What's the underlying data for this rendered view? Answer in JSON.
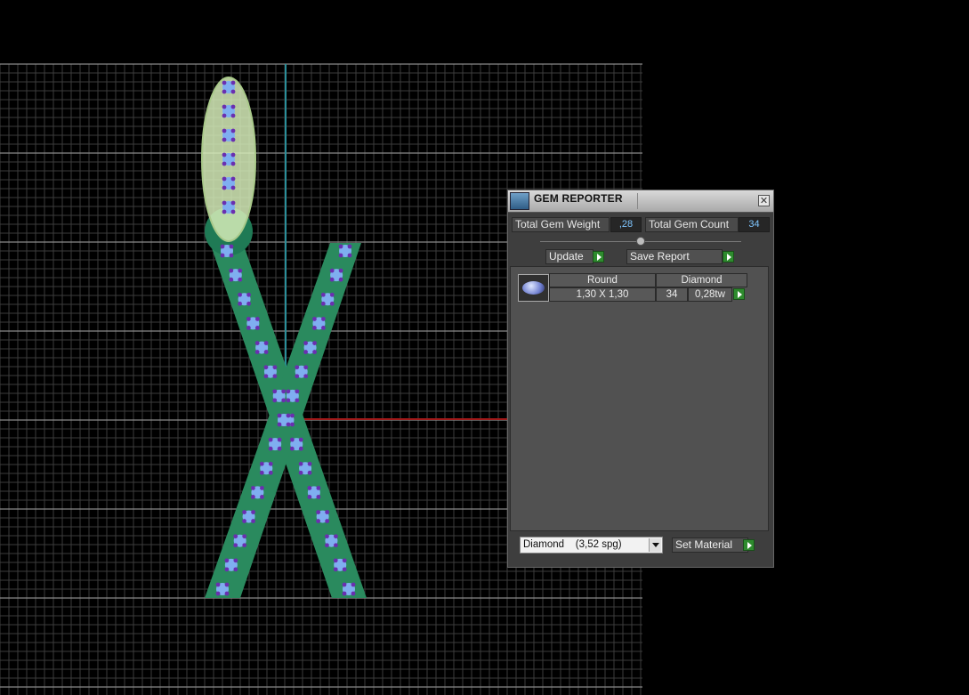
{
  "panel": {
    "title": "GEM REPORTER",
    "close_glyph": "✕",
    "total_weight_label": "Total Gem Weight",
    "total_weight_value": ",28",
    "total_count_label": "Total Gem Count",
    "total_count_value": "34",
    "update_label": "Update",
    "save_report_label": "Save Report",
    "gem_rows": [
      {
        "shape": "Round",
        "material": "Diamond",
        "size": "1,30 X 1,30",
        "count": "34",
        "weight": "0,28tw"
      }
    ],
    "material_select_value": "Diamond    (3,52 spg)",
    "set_material_label": "Set Material"
  },
  "colors": {
    "viewport_bg": "#000000",
    "grid": "#5a5a5a",
    "axis_vertical": "#2a8f9a",
    "axis_horizontal": "#a11a1a",
    "arm": "#2a8a5e",
    "gem_blue": "#7faef0",
    "gem_prong": "#6a2fb0",
    "accent_value": "#7fc6ff",
    "play_green": "#2e8b2e"
  },
  "icons": {
    "panel": "gem-reporter-icon",
    "close": "close-icon",
    "play": "play-arrow-icon",
    "gem_thumb": "round-gem-icon",
    "dropdown": "chevron-down-icon"
  }
}
